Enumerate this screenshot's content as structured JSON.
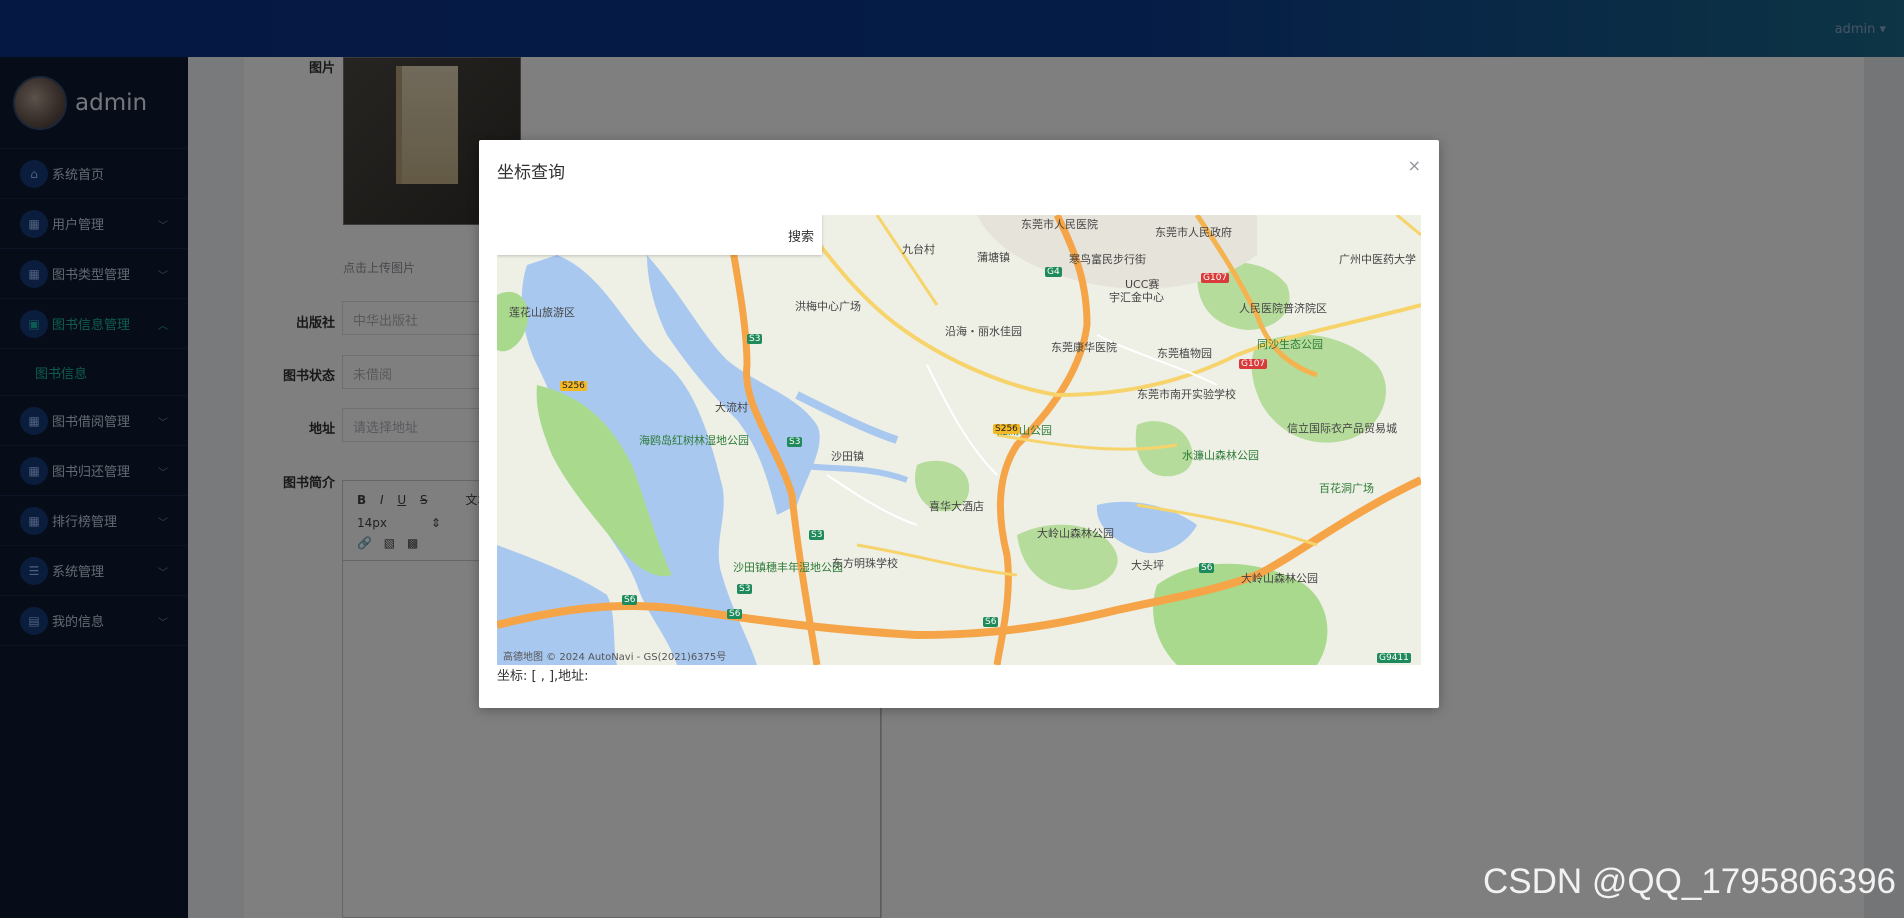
{
  "header": {
    "user": "admin ▾"
  },
  "sidebar": {
    "username": "admin",
    "items": [
      {
        "label": "系统首页"
      },
      {
        "label": "用户管理"
      },
      {
        "label": "图书类型管理"
      },
      {
        "label": "图书信息管理",
        "sub": "图书信息"
      },
      {
        "label": "图书借阅管理"
      },
      {
        "label": "图书归还管理"
      },
      {
        "label": "排行榜管理"
      },
      {
        "label": "系统管理"
      },
      {
        "label": "我的信息"
      }
    ]
  },
  "form": {
    "image_label": "图片",
    "upload_hint": "点击上传图片",
    "publisher_label": "出版社",
    "publisher_placeholder": "中华出版社",
    "status_label": "图书状态",
    "status_placeholder": "未借阅",
    "address_label": "地址",
    "address_placeholder": "请选择地址",
    "intro_label": "图书简介",
    "editor_toolbar": {
      "bold": "B",
      "italic": "I",
      "underline": "U",
      "strike": "S",
      "font_size": "14px",
      "text": "文本"
    }
  },
  "dialog": {
    "title": "坐标查询",
    "close": "×",
    "search_button": "搜索",
    "coords_text": "坐标: [ , ],地址:",
    "map": {
      "labels": [
        "东莞市人民医院",
        "东莞市人民政府",
        "九台村",
        "蒲塘镇",
        "广州中医药大学",
        "莲花山旅游区",
        "洪梅中心广场",
        "寒鸟富民步行街",
        "UCC赛",
        "宇汇金中心",
        "人民医院普济院区",
        "东莞康华医院",
        "东莞植物园",
        "同沙生态公园",
        "沿海・丽水佳园",
        "东莞市南开实验学校",
        "龙湖山公园",
        "信立国际衣产品贸易城",
        "水濂山森林公园",
        "海鸥岛红树林湿地公园",
        "沙田镇",
        "百花洞广场",
        "喜华大酒店",
        "大岭山森林公园",
        "大头坪",
        "大岭山森林公园",
        "沙田镇穗丰年湿地公园",
        "东方明珠学校",
        "大流村"
      ],
      "roads": [
        "S3",
        "S3",
        "S3",
        "S3",
        "S256",
        "S256",
        "G4",
        "G107",
        "G107",
        "S6",
        "S6",
        "S6",
        "S6",
        "G9411"
      ],
      "attribution": "高德地图  © 2024 AutoNavi - GS(2021)6375号"
    }
  },
  "watermark": "CSDN @QQ_1795806396"
}
